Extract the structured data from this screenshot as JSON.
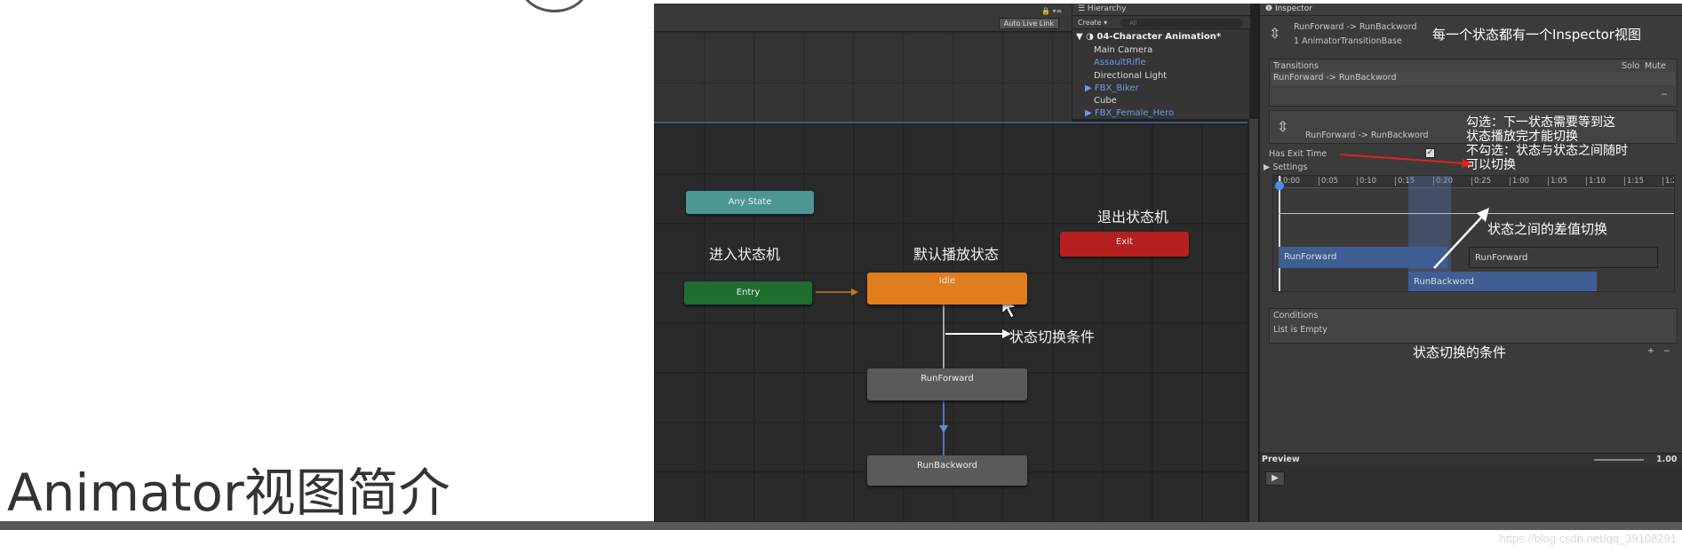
{
  "slide": {
    "title": "Animator视图简介",
    "watermark": "https://blog.csdn.net/qq_39108291"
  },
  "animator": {
    "auto_live_link": "Auto Live Link",
    "nodes": {
      "any_state": "Any State",
      "entry": "Entry",
      "idle": "Idle",
      "exit": "Exit",
      "run_forward": "RunForward",
      "run_backword": "RunBackword"
    },
    "labels": {
      "enter_state_machine": "进入状态机",
      "default_state": "默认播放状态",
      "exit_state_machine": "退出状态机",
      "transition_condition": "状态切换条件"
    },
    "colors": {
      "any_state": "#4a9793",
      "entry": "#1e6e30",
      "idle": "#e07d1c",
      "exit": "#b51f1f",
      "state": "#5a5a5a",
      "selection": "#3c5a86"
    }
  },
  "hierarchy": {
    "tab": "☰ Hierarchy",
    "create": "Create ▾",
    "search_placeholder": "All",
    "scene": "04-Character Animation*",
    "items": [
      {
        "label": "Main Camera",
        "color": "#dcdcdc"
      },
      {
        "label": "AssaultRifle",
        "color": "#6f9be8"
      },
      {
        "label": "Directional Light",
        "color": "#dcdcdc"
      },
      {
        "label": "FBX_Biker",
        "color": "#6f9be8"
      },
      {
        "label": "Cube",
        "color": "#dcdcdc"
      },
      {
        "label": "FBX_Female_Hero",
        "color": "#6f9be8"
      }
    ]
  },
  "inspector": {
    "tab": "Inspector",
    "header_title": "RunForward -> RunBackword",
    "header_sub": "1 AnimatorTransitionBase",
    "header_annotation": "每一个状态都有一个Inspector视图",
    "transitions_label": "Transitions",
    "solo": "Solo",
    "mute": "Mute",
    "transition_row": "RunForward -> RunBackword",
    "transition_detail": "RunForward -> RunBackword",
    "exit_time_annotation": [
      "勾选：下一状态需要等到这",
      "状态播放完才能切换",
      "不勾选：状态与状态之间随时",
      "可以切换"
    ],
    "has_exit_time": "Has Exit Time",
    "settings": "Settings",
    "timeline_ticks": [
      "0:00",
      "0:05",
      "0:10",
      "0:15",
      "0:20",
      "0:25",
      "1:00",
      "1:05",
      "1:10",
      "1:15",
      "1:2"
    ],
    "clips": {
      "from_a": "RunForward",
      "from_b": "RunForward",
      "to": "RunBackword"
    },
    "blend_annotation": "状态之间的差值切换",
    "conditions_label": "Conditions",
    "conditions_empty": "List is Empty",
    "conditions_annotation": "状态切换的条件",
    "preview_label": "Preview",
    "preview_speed": "1.00"
  }
}
